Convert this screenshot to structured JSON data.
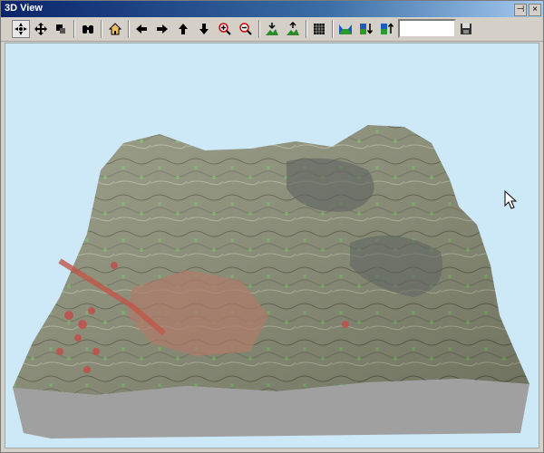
{
  "window": {
    "title": "3D View"
  },
  "titlebar_buttons": {
    "pin": "⊣",
    "close": "×"
  },
  "toolbar": {
    "scale_value": "",
    "tools": [
      "navigate-icon",
      "pan-icon",
      "layers-icon",
      "binoculars-icon",
      "home-icon",
      "arrow-left-icon",
      "arrow-right-icon",
      "arrow-up-icon",
      "arrow-down-icon",
      "zoom-in-icon",
      "zoom-out-icon",
      "terrain-down-icon",
      "terrain-up-icon",
      "grid-icon",
      "surface-icon",
      "lower-icon",
      "raise-icon",
      "save-icon"
    ]
  },
  "colors": {
    "titlebar_start": "#0a246a",
    "viewport_bg": "#cde9f7",
    "terrain_base": "#a0a0a0",
    "terrain_map": "#8a8e75"
  }
}
